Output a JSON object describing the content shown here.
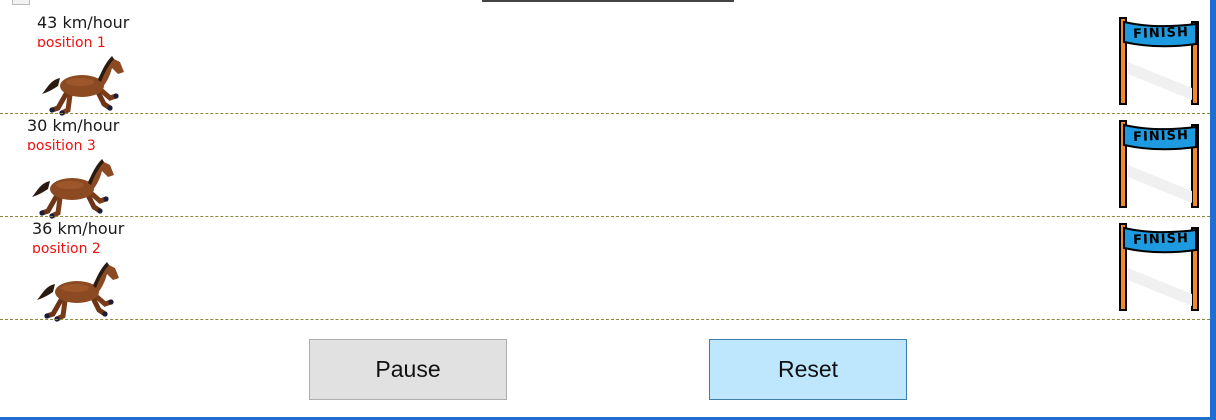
{
  "lanes": [
    {
      "speed": "43 km/hour",
      "position": "position 1",
      "horse_icon": "horse-icon",
      "finish_label": "FINISH"
    },
    {
      "speed": "30 km/hour",
      "position": "position 3",
      "horse_icon": "horse-icon",
      "finish_label": "FINISH"
    },
    {
      "speed": "36 km/hour",
      "position": "position 2",
      "horse_icon": "horse-icon",
      "finish_label": "FINISH"
    }
  ],
  "controls": {
    "pause_label": "Pause",
    "reset_label": "Reset"
  },
  "colors": {
    "position_text": "#ee1111",
    "lane_divider": "#8a8a3a",
    "pause_bg": "#e1e1e1",
    "reset_bg": "#bee6fd",
    "banner_blue": "#1e9be0",
    "pole_orange": "#f08a2c",
    "horse_brown": "#8b4a22"
  }
}
